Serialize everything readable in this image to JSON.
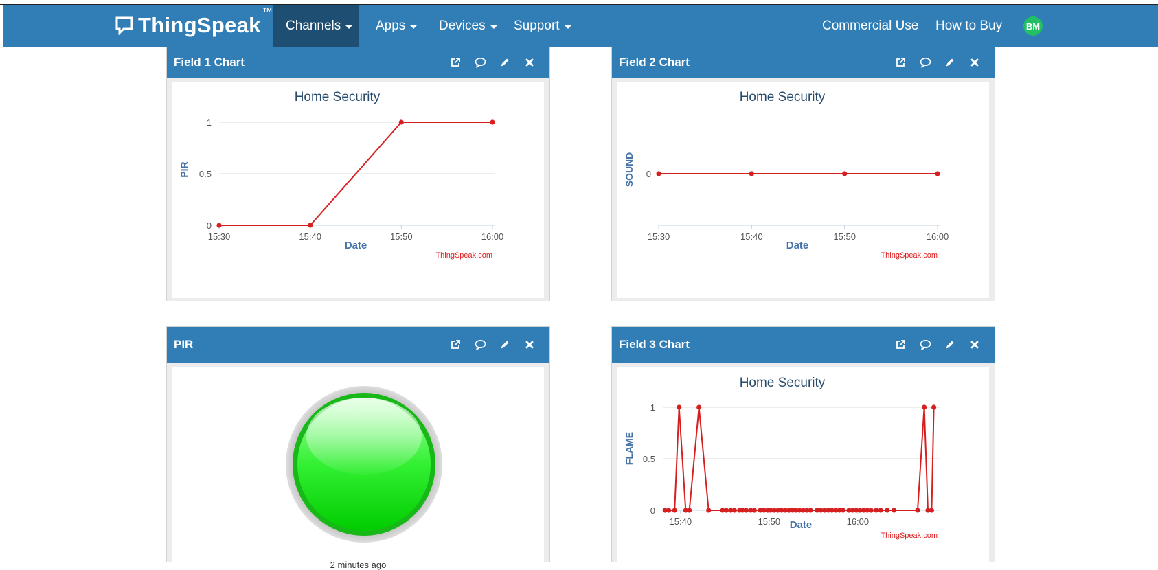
{
  "nav": {
    "logo": "ThingSpeak",
    "tm": "™",
    "items": [
      {
        "label": "Channels",
        "active": true
      },
      {
        "label": "Apps"
      },
      {
        "label": "Devices"
      },
      {
        "label": "Support"
      }
    ],
    "commercial": "Commercial Use",
    "how_to_buy": "How to Buy",
    "avatar": "BM"
  },
  "colors": {
    "brand": "#317db5",
    "active_nav": "#1e4f72",
    "series": "#d62020",
    "axis_label": "#4572a7",
    "lamp_on": "#00ee00",
    "avatar": "#21c064"
  },
  "panels": {
    "field1": {
      "title": "Field 1 Chart"
    },
    "field2": {
      "title": "Field 2 Chart"
    },
    "pir": {
      "title": "PIR",
      "caption": "2 minutes ago",
      "lamp_state": "on"
    },
    "field3": {
      "title": "Field 3 Chart"
    }
  },
  "tool_icons": [
    "external-link-icon",
    "comment-icon",
    "pencil-icon",
    "close-icon"
  ],
  "credit": "ThingSpeak.com",
  "chart_data": [
    {
      "id": "field1",
      "type": "line",
      "title": "Home Security",
      "xlabel": "Date",
      "ylabel": "PIR",
      "x_ticks": [
        "15:30",
        "15:40",
        "15:50",
        "16:00"
      ],
      "y_ticks": [
        0,
        0.5,
        1
      ],
      "ylim": [
        0,
        1
      ],
      "xlim": [
        "15:30",
        "16:00"
      ],
      "grid": true,
      "series": [
        {
          "x": [
            "15:30",
            "15:40",
            "15:50",
            "16:00"
          ],
          "values": [
            0,
            0,
            1,
            1
          ]
        }
      ]
    },
    {
      "id": "field2",
      "type": "line",
      "title": "Home Security",
      "xlabel": "Date",
      "ylabel": "SOUND",
      "x_ticks": [
        "15:30",
        "15:40",
        "15:50",
        "16:00"
      ],
      "y_ticks": [
        0
      ],
      "ylim": [
        -1,
        1
      ],
      "xlim": [
        "15:30",
        "16:00"
      ],
      "grid": true,
      "series": [
        {
          "x": [
            "15:30",
            "15:40",
            "15:50",
            "16:00"
          ],
          "values": [
            0,
            0,
            0,
            0
          ]
        }
      ]
    },
    {
      "id": "field3",
      "type": "line",
      "title": "Home Security",
      "xlabel": "Date",
      "ylabel": "FLAME",
      "x_ticks": [
        "15:40",
        "15:50",
        "16:00"
      ],
      "y_ticks": [
        0,
        0.5,
        1
      ],
      "ylim": [
        0,
        1
      ],
      "xlim": [
        "15:38",
        "16:09"
      ],
      "grid": true,
      "series": [
        {
          "x": [
            "15:38:15",
            "15:38:40",
            "15:39:20",
            "15:39:50",
            "15:40:35",
            "15:41:00",
            "15:42:05",
            "15:43:10",
            "15:44:45",
            "15:45:10",
            "15:45:40",
            "15:46:05",
            "15:46:40",
            "15:47:00",
            "15:47:25",
            "15:47:55",
            "15:48:20",
            "15:49:00",
            "15:49:25",
            "15:49:50",
            "15:50:10",
            "15:50:35",
            "15:51:00",
            "15:51:25",
            "15:51:50",
            "15:52:15",
            "15:52:40",
            "15:53:00",
            "15:53:25",
            "15:53:50",
            "15:54:15",
            "15:54:40",
            "15:55:25",
            "15:55:50",
            "15:56:15",
            "15:56:40",
            "15:57:05",
            "15:57:30",
            "15:57:55",
            "15:58:20",
            "15:59:00",
            "15:59:25",
            "15:59:50",
            "16:00:15",
            "16:00:40",
            "16:01:05",
            "16:01:30",
            "16:02:05",
            "16:02:35",
            "16:03:20",
            "16:04:05",
            "16:06:45",
            "16:07:30",
            "16:07:55",
            "16:08:20",
            "16:08:35"
          ],
          "values": [
            0,
            0,
            0,
            1,
            0,
            0,
            1,
            0,
            0,
            0,
            0,
            0,
            0,
            0,
            0,
            0,
            0,
            0,
            0,
            0,
            0,
            0,
            0,
            0,
            0,
            0,
            0,
            0,
            0,
            0,
            0,
            0,
            0,
            0,
            0,
            0,
            0,
            0,
            0,
            0,
            0,
            0,
            0,
            0,
            0,
            0,
            0,
            0,
            0,
            0,
            0,
            0,
            1,
            0,
            0,
            1
          ]
        }
      ]
    }
  ]
}
